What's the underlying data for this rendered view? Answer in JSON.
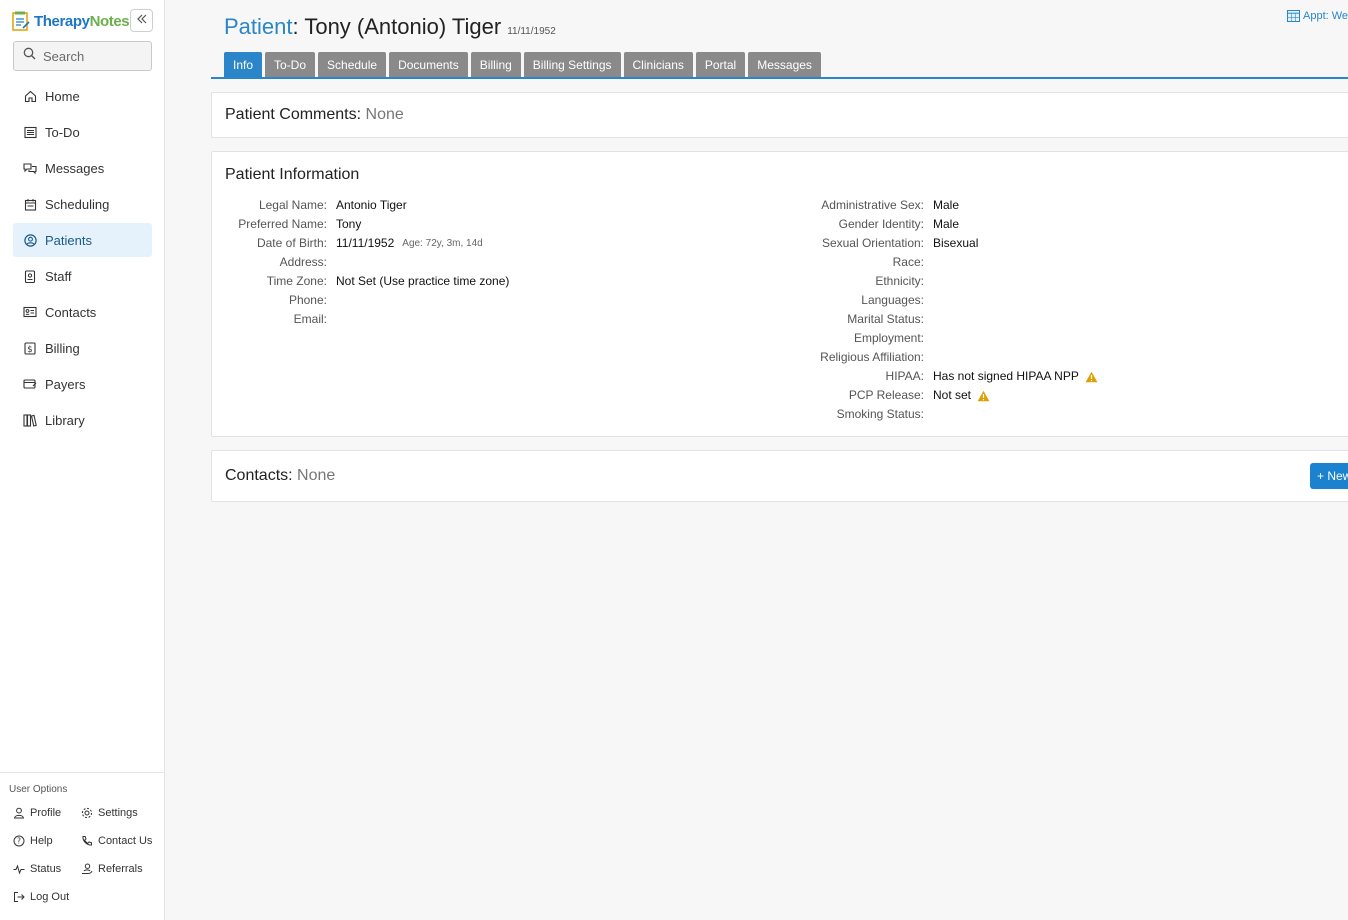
{
  "app": {
    "logo_part1": "Therapy",
    "logo_part2": "Notes"
  },
  "sidebar": {
    "search_placeholder": "Search",
    "items": [
      {
        "label": "Home"
      },
      {
        "label": "To-Do"
      },
      {
        "label": "Messages"
      },
      {
        "label": "Scheduling"
      },
      {
        "label": "Patients"
      },
      {
        "label": "Staff"
      },
      {
        "label": "Contacts"
      },
      {
        "label": "Billing"
      },
      {
        "label": "Payers"
      },
      {
        "label": "Library"
      }
    ],
    "active_item": "Patients",
    "user_options": {
      "title": "User Options",
      "profile": "Profile",
      "settings": "Settings",
      "help": "Help",
      "contact_us": "Contact Us",
      "status": "Status",
      "referrals": "Referrals",
      "log_out": "Log Out"
    }
  },
  "header": {
    "label": "Patient",
    "separator": ": ",
    "name": "Tony (Antonio) Tiger",
    "dob": "11/11/1952",
    "appt_link": "Appt: Wed"
  },
  "tabs": [
    {
      "label": "Info",
      "active": true
    },
    {
      "label": "To-Do"
    },
    {
      "label": "Schedule"
    },
    {
      "label": "Documents"
    },
    {
      "label": "Billing"
    },
    {
      "label": "Billing Settings"
    },
    {
      "label": "Clinicians"
    },
    {
      "label": "Portal"
    },
    {
      "label": "Messages"
    }
  ],
  "comments": {
    "label": "Patient Comments:",
    "value": "None"
  },
  "patient_info": {
    "title": "Patient Information",
    "left": [
      {
        "key": "Legal Name:",
        "value": "Antonio Tiger"
      },
      {
        "key": "Preferred Name:",
        "value": "Tony"
      },
      {
        "key": "Date of Birth:",
        "value": "11/11/1952",
        "sub": "Age: 72y, 3m, 14d"
      },
      {
        "key": "Address:",
        "value": ""
      },
      {
        "key": "Time Zone:",
        "value": "Not Set (Use practice time zone)"
      },
      {
        "key": "Phone:",
        "value": ""
      },
      {
        "key": "Email:",
        "value": ""
      }
    ],
    "right": [
      {
        "key": "Administrative Sex:",
        "value": "Male"
      },
      {
        "key": "Gender Identity:",
        "value": "Male"
      },
      {
        "key": "Sexual Orientation:",
        "value": "Bisexual"
      },
      {
        "key": "Race:",
        "value": ""
      },
      {
        "key": "Ethnicity:",
        "value": ""
      },
      {
        "key": "Languages:",
        "value": ""
      },
      {
        "key": "Marital Status:",
        "value": ""
      },
      {
        "key": "Employment:",
        "value": ""
      },
      {
        "key": "Religious Affiliation:",
        "value": ""
      },
      {
        "key": "HIPAA:",
        "value": "Has not signed HIPAA NPP",
        "warning": true
      },
      {
        "key": "PCP Release:",
        "value": "Not set",
        "warning": true
      },
      {
        "key": "Smoking Status:",
        "value": ""
      }
    ]
  },
  "contacts": {
    "label": "Contacts:",
    "value": "None",
    "new_button": "+ New"
  },
  "colors": {
    "accent": "#2a86c8",
    "tab_inactive": "#8a8a8a",
    "warning": "#e0a100"
  }
}
